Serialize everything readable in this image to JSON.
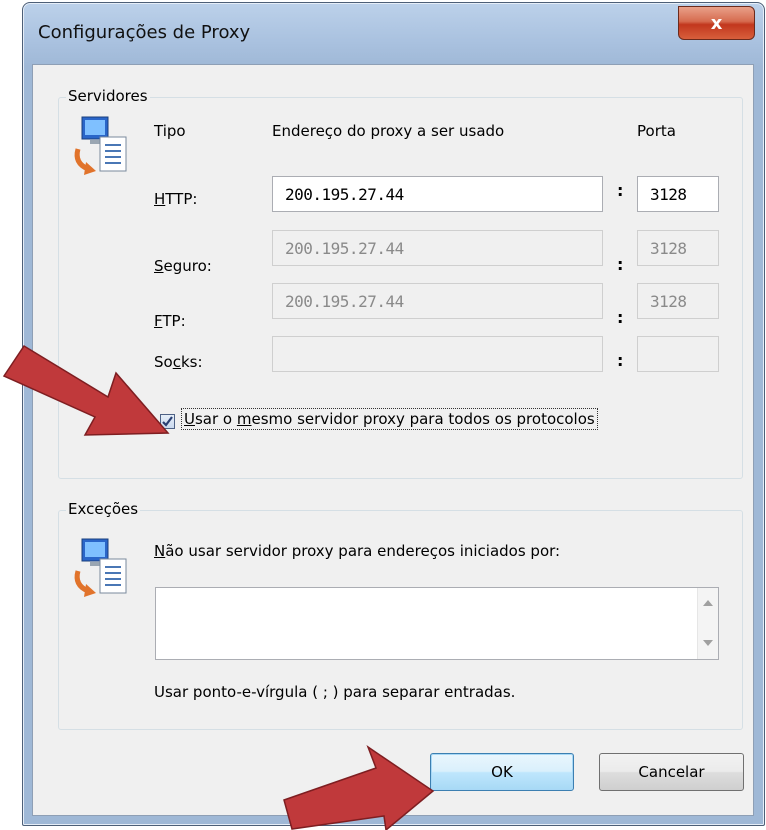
{
  "window": {
    "title": "Configurações de Proxy",
    "close_glyph": "x"
  },
  "servers": {
    "legend": "Servidores",
    "headers": {
      "type": "Tipo",
      "address": "Endereço do proxy a ser usado",
      "port": "Porta"
    },
    "rows": [
      {
        "accel": "H",
        "rest": "TTP:",
        "address": "200.195.27.44",
        "port": "3128",
        "enabled": true
      },
      {
        "accel": "S",
        "rest": "eguro:",
        "address": "200.195.27.44",
        "port": "3128",
        "enabled": false
      },
      {
        "accel": "F",
        "rest": "TP:",
        "address": "200.195.27.44",
        "port": "3128",
        "enabled": false
      },
      {
        "pre": "So",
        "accel": "c",
        "rest": "ks:",
        "address": "",
        "port": "",
        "enabled": false
      }
    ],
    "colon": ":",
    "same_proxy": {
      "checked": true,
      "pre": "U",
      "mid1": "sar o ",
      "accel": "m",
      "rest": "esmo servidor proxy para todos os protocolos"
    }
  },
  "exceptions": {
    "legend": "Exceções",
    "prompt_accel": "N",
    "prompt_rest": "ão usar servidor proxy para endereços iniciados por:",
    "value": "",
    "hint": "Usar ponto-e-vírgula ( ; ) para separar entradas."
  },
  "buttons": {
    "ok": "OK",
    "cancel": "Cancelar"
  },
  "colors": {
    "arrow": "#c0393b",
    "title_bar": "#a9c1df",
    "client": "#f0f0f0"
  }
}
